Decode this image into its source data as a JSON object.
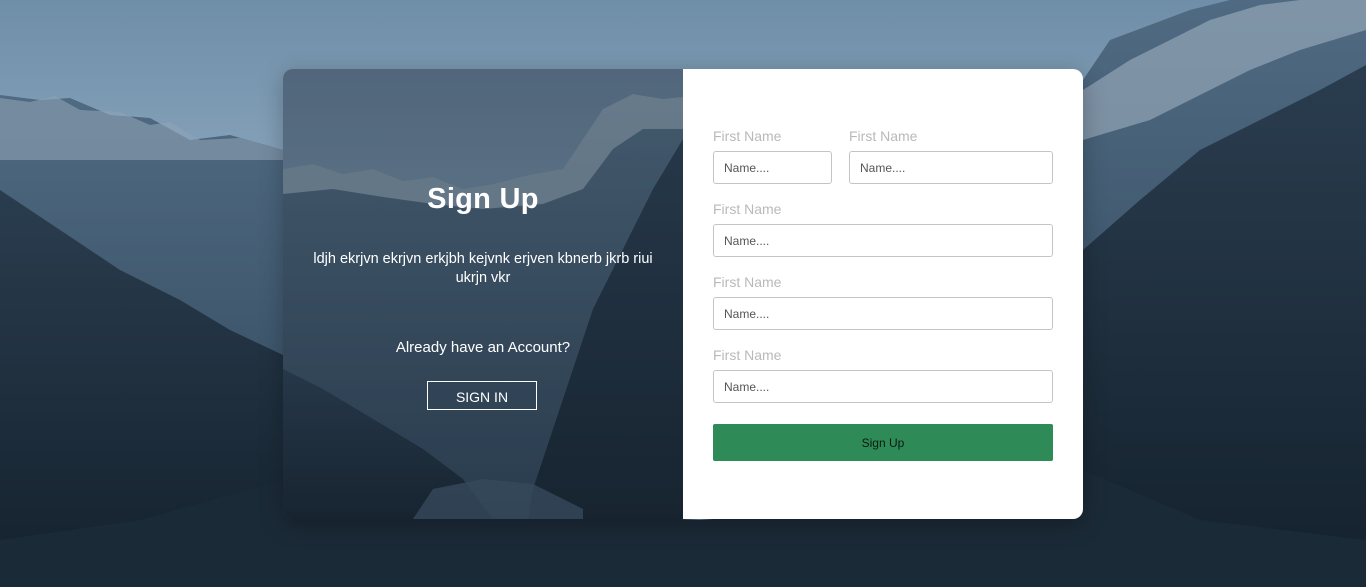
{
  "left_panel": {
    "title": "Sign Up",
    "description": "ldjh ekrjvn ekrjvn erkjbh kejvnk erjven kbnerb jkrb riui ukrjn vkr",
    "question": "Already have an Account?",
    "signin_label": "SIGN IN"
  },
  "form": {
    "fields": [
      {
        "label": "First Name",
        "placeholder": "Name...."
      },
      {
        "label": "First Name",
        "placeholder": "Name...."
      },
      {
        "label": "First Name",
        "placeholder": "Name...."
      },
      {
        "label": "First Name",
        "placeholder": "Name...."
      },
      {
        "label": "First Name",
        "placeholder": "Name...."
      }
    ],
    "submit_label": "Sign Up"
  },
  "colors": {
    "submit_button": "#2e8b57",
    "label": "#b9b9b9",
    "sky": "#7f9bb3",
    "mountain_dark": "#1f3040"
  },
  "background": {
    "icon": "mountain-landscape-image"
  }
}
